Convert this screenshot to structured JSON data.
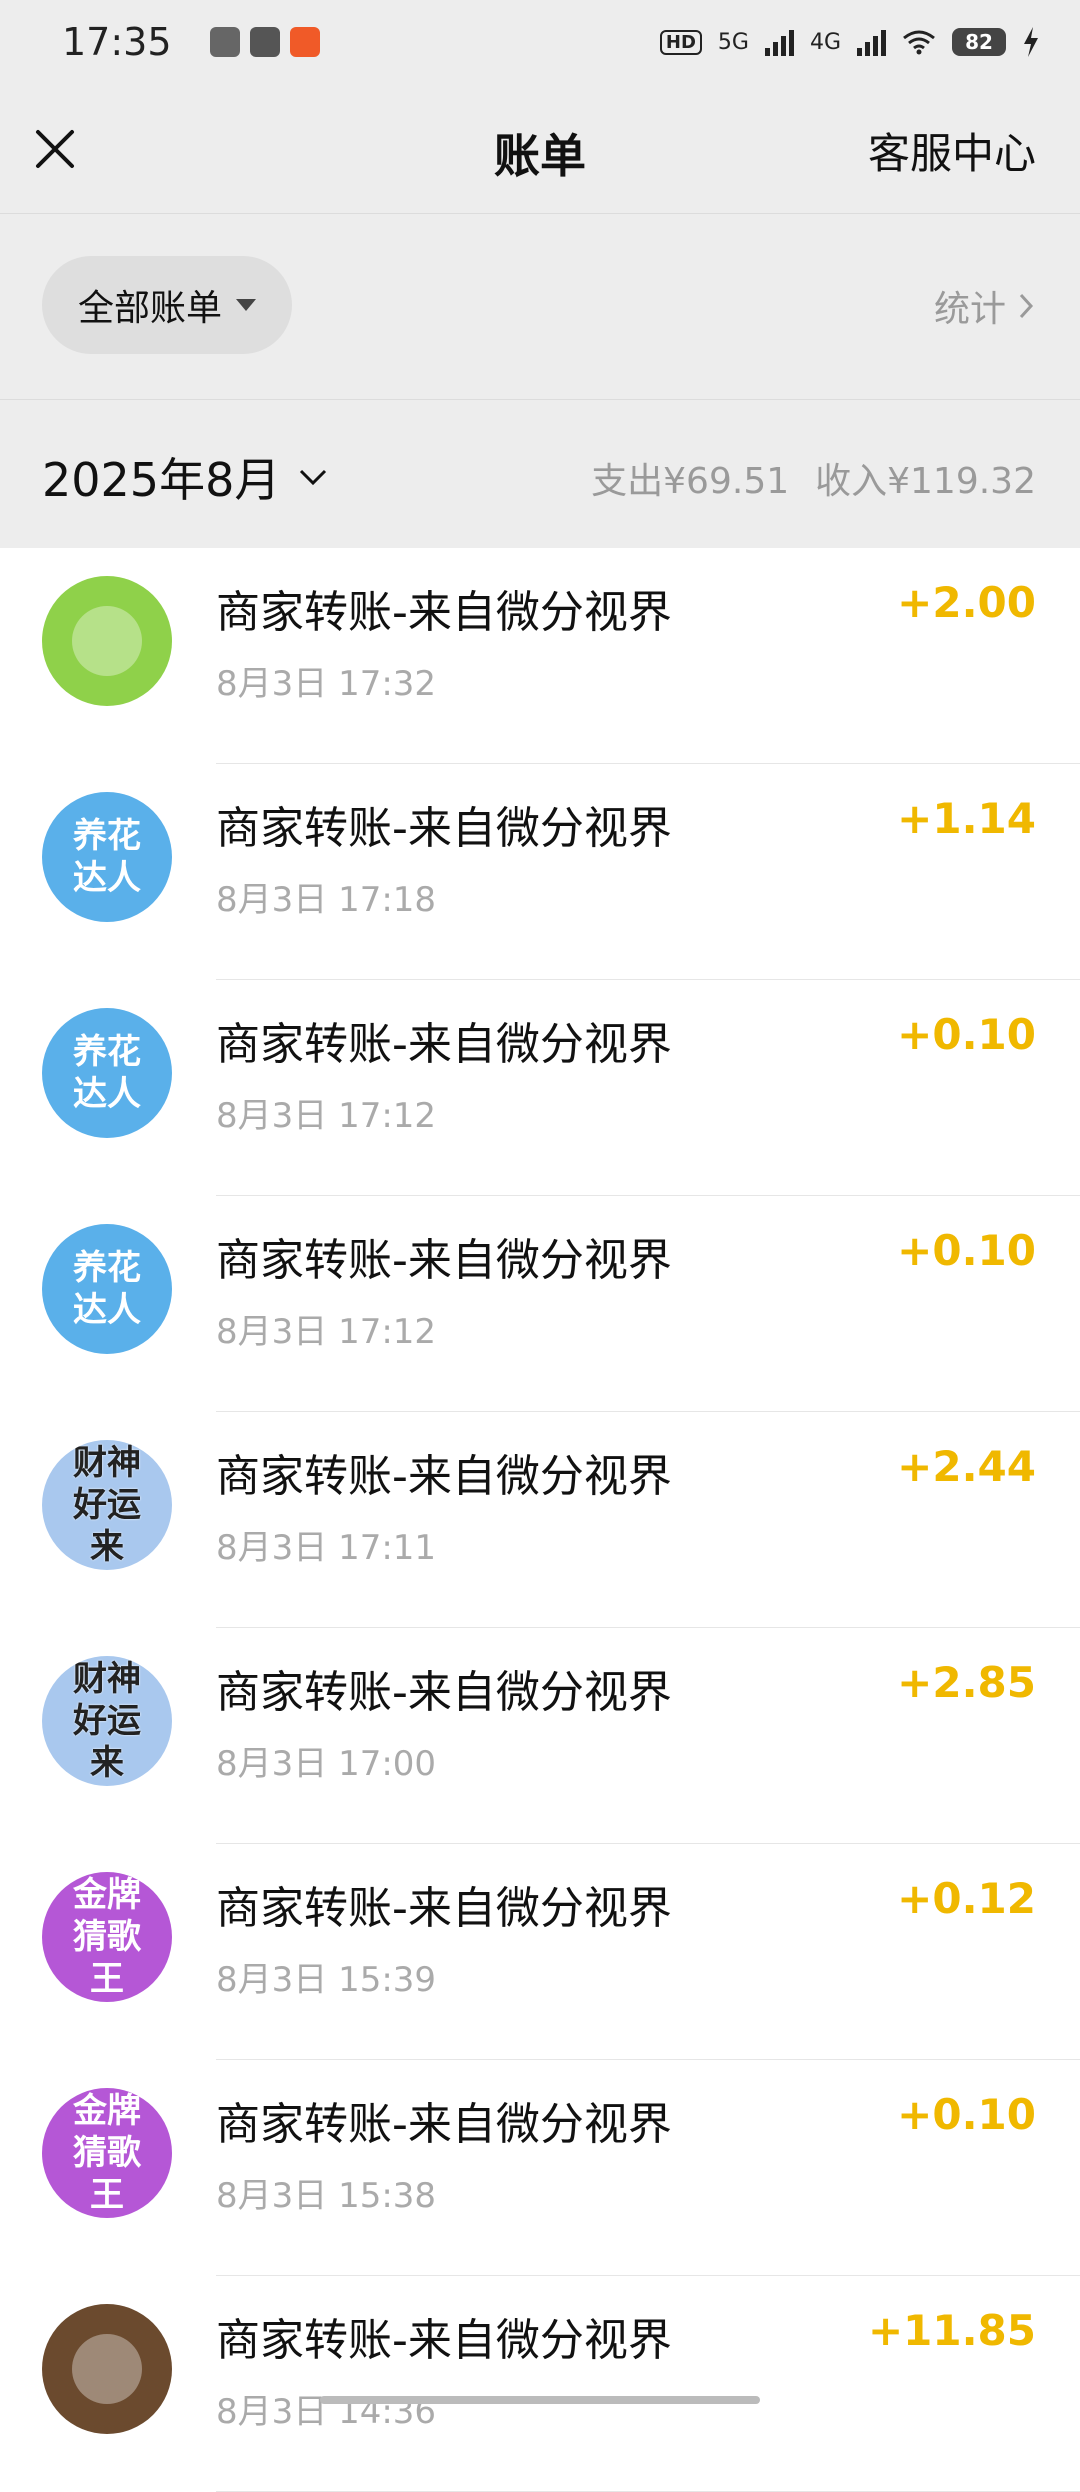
{
  "status": {
    "time": "17:35",
    "network1": "5G",
    "network2": "4G",
    "hd": "HD",
    "battery": "82"
  },
  "header": {
    "title": "账单",
    "service_label": "客服中心",
    "close_icon": "close-icon"
  },
  "filter": {
    "selected": "全部账单",
    "stats_label": "统计"
  },
  "month": {
    "label": "2025年8月",
    "expense": "支出¥69.51",
    "income": "收入¥119.32"
  },
  "transactions": [
    {
      "name": "商家转账-来自微分视界",
      "date": "8月3日 17:32",
      "amount": "+2.00",
      "avatar_text": "",
      "avatar_color": "#8fd14a"
    },
    {
      "name": "商家转账-来自微分视界",
      "date": "8月3日 17:18",
      "amount": "+1.14",
      "avatar_text": "养花达人",
      "avatar_color": "#5ab0ea"
    },
    {
      "name": "商家转账-来自微分视界",
      "date": "8月3日 17:12",
      "amount": "+0.10",
      "avatar_text": "养花达人",
      "avatar_color": "#5ab0ea"
    },
    {
      "name": "商家转账-来自微分视界",
      "date": "8月3日 17:12",
      "amount": "+0.10",
      "avatar_text": "养花达人",
      "avatar_color": "#5ab0ea"
    },
    {
      "name": "商家转账-来自微分视界",
      "date": "8月3日 17:11",
      "amount": "+2.44",
      "avatar_text": "财神好运来",
      "avatar_color": "#a9c8ee"
    },
    {
      "name": "商家转账-来自微分视界",
      "date": "8月3日 17:00",
      "amount": "+2.85",
      "avatar_text": "财神好运来",
      "avatar_color": "#a9c8ee"
    },
    {
      "name": "商家转账-来自微分视界",
      "date": "8月3日 15:39",
      "amount": "+0.12",
      "avatar_text": "金牌猜歌王",
      "avatar_color": "#b557d6"
    },
    {
      "name": "商家转账-来自微分视界",
      "date": "8月3日 15:38",
      "amount": "+0.10",
      "avatar_text": "金牌猜歌王",
      "avatar_color": "#b557d6"
    },
    {
      "name": "商家转账-来自微分视界",
      "date": "8月3日 14:36",
      "amount": "+11.85",
      "avatar_text": "",
      "avatar_color": "#6b4a2e"
    }
  ]
}
